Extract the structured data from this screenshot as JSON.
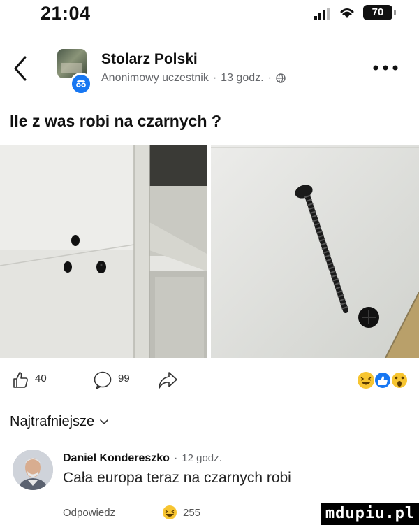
{
  "status_bar": {
    "time": "21:04",
    "battery": "70",
    "icons": [
      "signal-icon",
      "wifi-icon",
      "battery-icon"
    ]
  },
  "post": {
    "group_name": "Stolarz Polski",
    "author": "Anonimowy uczestnik",
    "time": "13 godz.",
    "separator": "·",
    "text": "Ile z was robi na czarnych ?",
    "photos": [
      "screw-holes-photo",
      "black-screw-photo"
    ],
    "actions": {
      "likes": "40",
      "comments": "99"
    },
    "reaction_icons": [
      "haha-reaction-icon",
      "like-reaction-icon",
      "wow-reaction-icon"
    ]
  },
  "comments": {
    "sort_label": "Najtrafniejsze",
    "items": [
      {
        "name": "Daniel Kondereszko",
        "time": "12 godz.",
        "text": "Cała europa teraz na czarnych robi",
        "reply_label": "Odpowiedz",
        "reaction_count": "255"
      }
    ]
  },
  "watermark": "mdupiu.pl",
  "colors": {
    "accent": "#1877f2",
    "secondary_text": "#65676b"
  }
}
